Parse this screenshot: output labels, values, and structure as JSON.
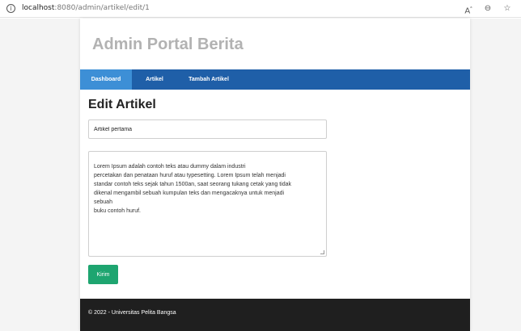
{
  "browser": {
    "url_host": "localhost",
    "url_path": ":8080/admin/artikel/edit/1",
    "icons": [
      "read-aloud-icon",
      "zoom-out-icon",
      "add-favorite-icon"
    ]
  },
  "header": {
    "title": "Admin Portal Berita"
  },
  "nav": {
    "items": [
      {
        "label": "Dashboard",
        "active": true
      },
      {
        "label": "Artikel",
        "active": false
      },
      {
        "label": "Tambah Artikel",
        "active": false
      }
    ]
  },
  "form": {
    "heading": "Edit Artikel",
    "title_value": "Artikel pertama",
    "content_lines": [
      "",
      "Lorem Ipsum adalah contoh teks atau dummy dalam industri",
      "percetakan dan penataan huruf atau typesetting. Lorem Ipsum telah menjadi",
      "standar contoh teks sejak tahun 1500an, saat seorang tukang cetak yang tidak",
      "dikenal mengambil sebuah kumpulan teks dan mengacaknya untuk menjadi",
      "sebuah",
      "buku contoh huruf."
    ],
    "submit_label": "Kirim"
  },
  "footer": {
    "text": "© 2022 - Universitas Pelita Bangsa"
  },
  "colors": {
    "navbar": "#1f5fa8",
    "nav_active": "#3d8fd6",
    "submit": "#1ea570",
    "footer": "#1f1f1f"
  }
}
